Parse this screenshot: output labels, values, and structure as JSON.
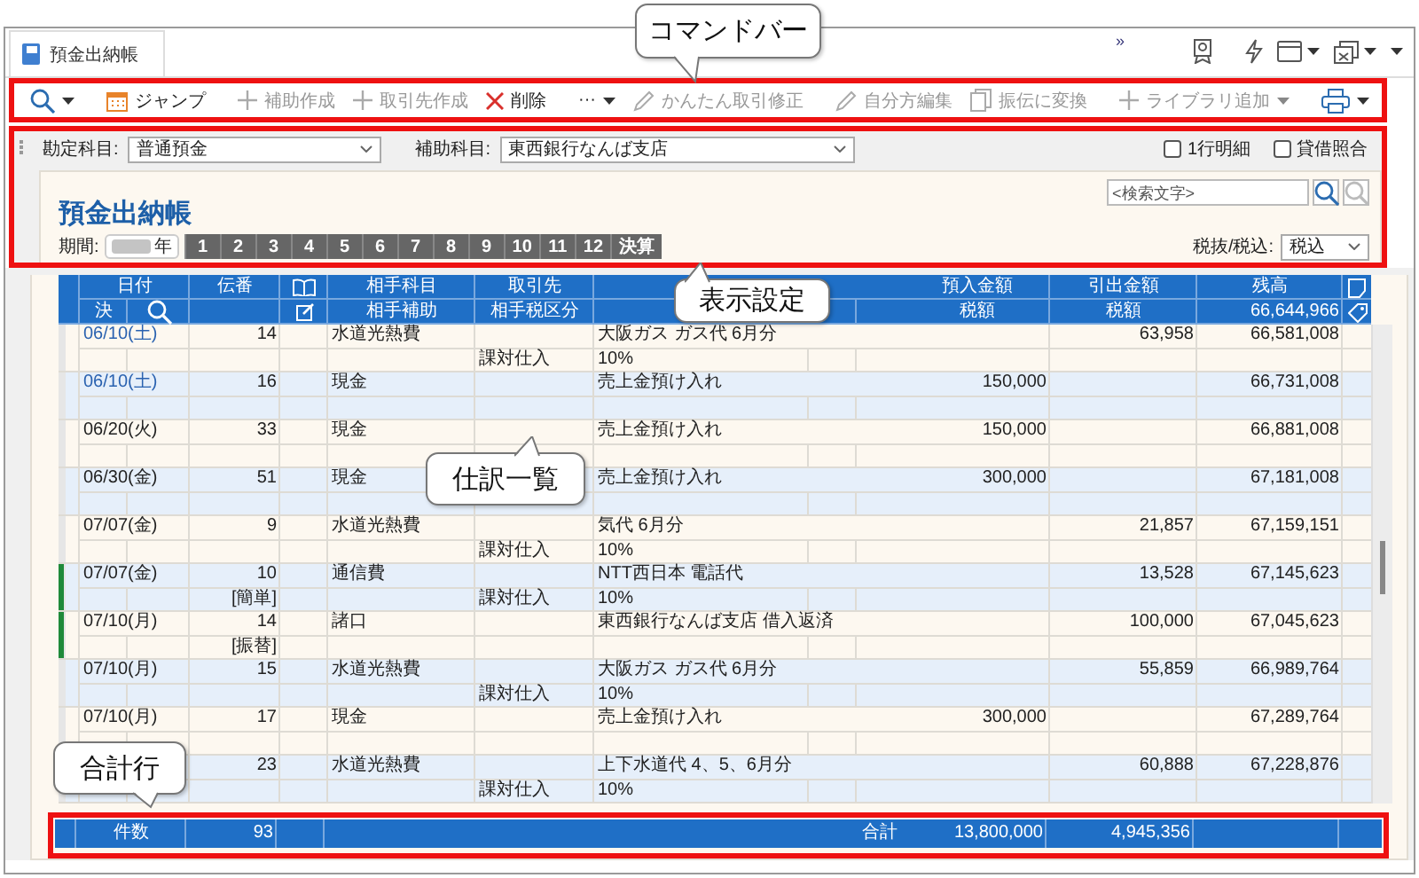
{
  "tab": {
    "title": "預金出納帳"
  },
  "window_controls": {
    "overflow": "»"
  },
  "command_bar": {
    "left": [
      {
        "label": "ジャンプ",
        "disabled": false
      },
      {
        "label": "補助作成",
        "disabled": true
      },
      {
        "label": "取引先作成",
        "disabled": true
      },
      {
        "label": "削除",
        "disabled": false
      }
    ],
    "more": "···",
    "right": [
      {
        "label": "かんたん取引修正",
        "disabled": true,
        "has_menu": false
      },
      {
        "label": "自分方編集",
        "disabled": true,
        "has_menu": false
      },
      {
        "label": "振伝に変換",
        "disabled": true,
        "has_menu": false
      },
      {
        "label": "ライブラリ追加",
        "disabled": true,
        "has_menu": true
      }
    ]
  },
  "filters": {
    "account": {
      "label": "勘定科目:",
      "value": "普通預金"
    },
    "sub_account": {
      "label": "補助科目:",
      "value": "東西銀行なんば支店"
    },
    "options": [
      {
        "label": "1行明細",
        "checked": false
      },
      {
        "label": "貸借照合",
        "checked": false
      }
    ]
  },
  "ledger_header": {
    "title": "預金出納帳",
    "search": {
      "placeholder": "<検索文字>"
    },
    "period": {
      "label": "期間:",
      "year_suffix": "年",
      "months": [
        "1",
        "2",
        "3",
        "4",
        "5",
        "6",
        "7",
        "8",
        "9",
        "10",
        "11",
        "12",
        "決算"
      ]
    },
    "tax": {
      "label": "税抜/税込:",
      "value": "税込"
    }
  },
  "table": {
    "columns_top": [
      "日付",
      "伝番",
      "相手科目",
      "取引先",
      "預入金額",
      "引出金額",
      "残高"
    ],
    "columns_bottom": [
      "決",
      "相手補助",
      "相手税区分",
      "税額",
      "税額"
    ],
    "opening_balance": "66,644,966",
    "rows": [
      {
        "date": "06/10(土)",
        "saturday": true,
        "flagged": false,
        "number": "14",
        "account": "水道光熱費",
        "description": "大阪ガス ガス代 6月分",
        "withdrawal": "63,958",
        "balance": "66,581,008",
        "tax_category": "課対仕入",
        "tax_rate": "10%"
      },
      {
        "date": "06/10(土)",
        "saturday": true,
        "flagged": false,
        "number": "16",
        "account": "現金",
        "description": "売上金預け入れ",
        "deposit": "150,000",
        "balance": "66,731,008"
      },
      {
        "date": "06/20(火)",
        "saturday": false,
        "flagged": false,
        "number": "33",
        "account": "現金",
        "description": "売上金預け入れ",
        "deposit": "150,000",
        "balance": "66,881,008"
      },
      {
        "date": "06/30(金)",
        "saturday": false,
        "flagged": false,
        "number": "51",
        "account": "現金",
        "description": "売上金預け入れ",
        "deposit": "300,000",
        "balance": "67,181,008"
      },
      {
        "date": "07/07(金)",
        "saturday": false,
        "flagged": false,
        "number": "9",
        "account": "水道光熱費",
        "description": "気代 6月分",
        "withdrawal": "21,857",
        "balance": "67,159,151",
        "tax_category": "課対仕入",
        "tax_rate": "10%"
      },
      {
        "date": "07/07(金)",
        "saturday": false,
        "flagged": true,
        "number": "10",
        "note": "[簡単]",
        "account": "通信費",
        "description": "NTT西日本 電話代",
        "withdrawal": "13,528",
        "balance": "67,145,623",
        "tax_category": "課対仕入",
        "tax_rate": "10%"
      },
      {
        "date": "07/10(月)",
        "saturday": false,
        "flagged": true,
        "number": "14",
        "note": "[振替]",
        "account": "諸口",
        "description": "東西銀行なんば支店 借入返済",
        "withdrawal": "100,000",
        "balance": "67,045,623"
      },
      {
        "date": "07/10(月)",
        "saturday": false,
        "flagged": false,
        "number": "15",
        "account": "水道光熱費",
        "description": "大阪ガス ガス代 6月分",
        "withdrawal": "55,859",
        "balance": "66,989,764",
        "tax_category": "課対仕入",
        "tax_rate": "10%"
      },
      {
        "date": "07/10(月)",
        "saturday": false,
        "flagged": false,
        "number": "17",
        "account": "現金",
        "description": "売上金預け入れ",
        "deposit": "300,000",
        "balance": "67,289,764"
      },
      {
        "flagged": false,
        "number": "23",
        "account": "水道光熱費",
        "description": "上下水道代 4、5、6月分",
        "withdrawal": "60,888",
        "balance": "67,228,876",
        "tax_category": "課対仕入",
        "tax_rate": "10%"
      }
    ],
    "total": {
      "label": "件数",
      "count": "93",
      "sum_label": "合計",
      "deposit": "13,800,000",
      "withdrawal": "4,945,356"
    }
  },
  "callouts": [
    {
      "text": "コマンドバー"
    },
    {
      "text": "表示設定"
    },
    {
      "text": "仕訳一覧"
    },
    {
      "text": "合計行"
    }
  ]
}
